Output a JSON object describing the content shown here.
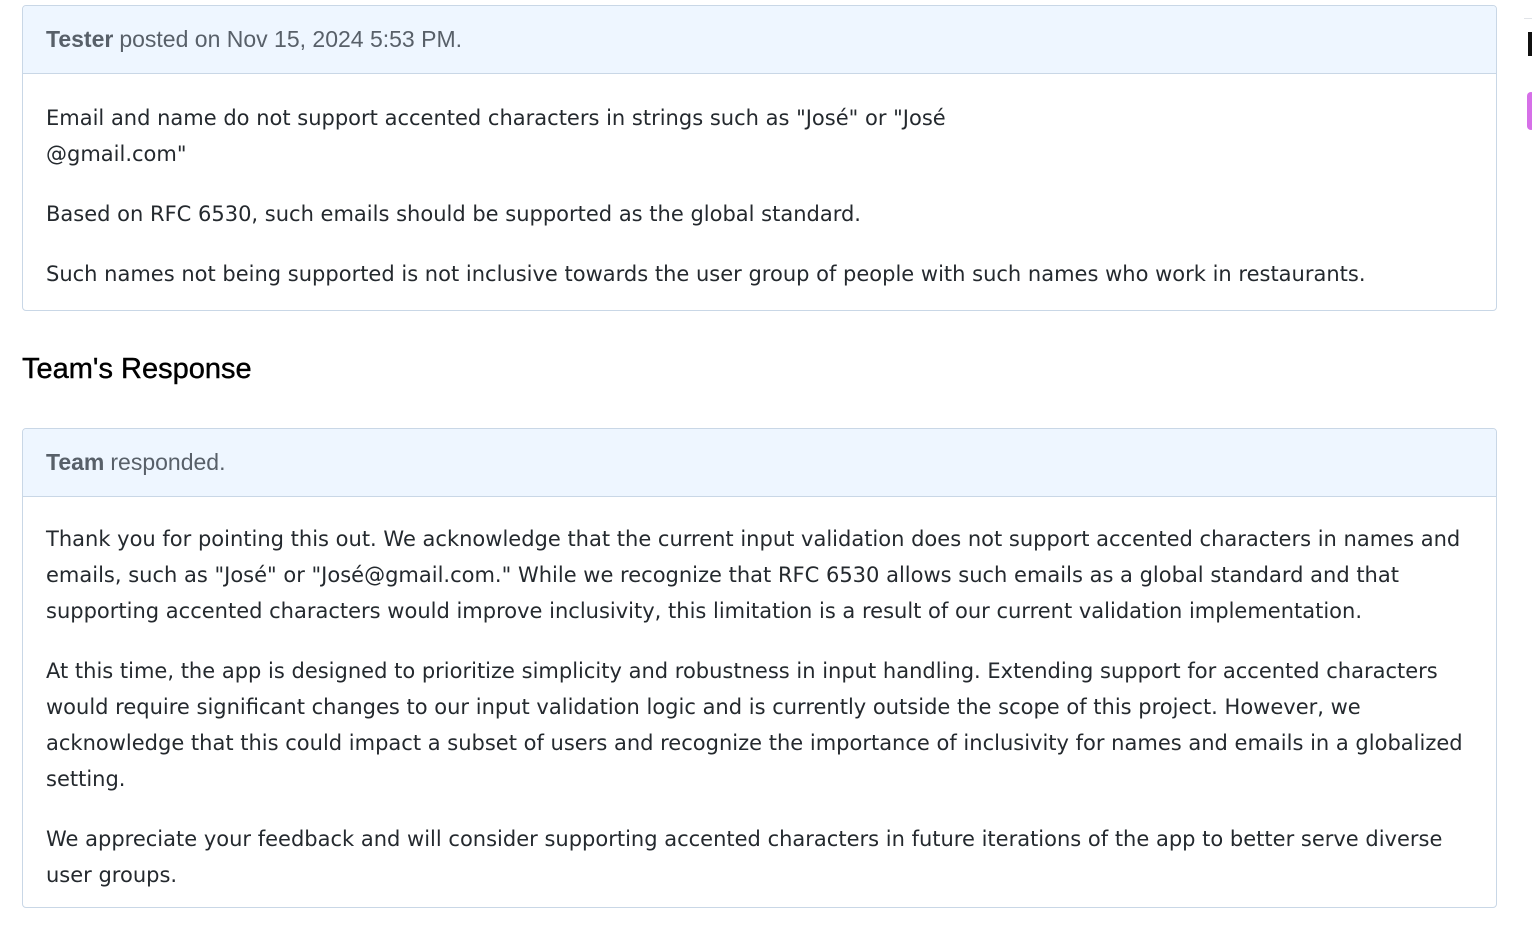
{
  "issue": {
    "author": "Tester",
    "posted_text": "posted on Nov 15, 2024 5:53 PM.",
    "paragraphs": [
      "Email and name do not support accented characters in strings such as \"José\" or \"José\n@gmail.com\"",
      "Based on RFC 6530, such emails should be supported as the global standard.",
      "Such names not being supported is not inclusive towards the user group of people with such names who work in restaurants."
    ]
  },
  "response_section": {
    "heading": "Team's Response"
  },
  "response": {
    "author": "Team",
    "status_text": "responded.",
    "paragraphs": [
      "Thank you for pointing this out. We acknowledge that the current input validation does not support accented characters in names and emails, such as \"José\" or \"José@gmail.com.\" While we recognize that RFC 6530 allows such emails as a global standard and that supporting accented characters would improve inclusivity, this limitation is a result of our current validation implementation.",
      "At this time, the app is designed to prioritize simplicity and robustness in input handling. Extending support for accented characters would require significant changes to our input validation logic and is currently outside the scope of this project. However, we acknowledge that this could impact a subset of users and recognize the importance of inclusivity for names and emails in a globalized setting.",
      "We appreciate your feedback and will consider supporting accented characters in future iterations of the app to better serve diverse user groups."
    ]
  },
  "colors": {
    "header_bg": "#eef6ff",
    "border": "#c9d7e6",
    "badge": "#d670e8"
  }
}
